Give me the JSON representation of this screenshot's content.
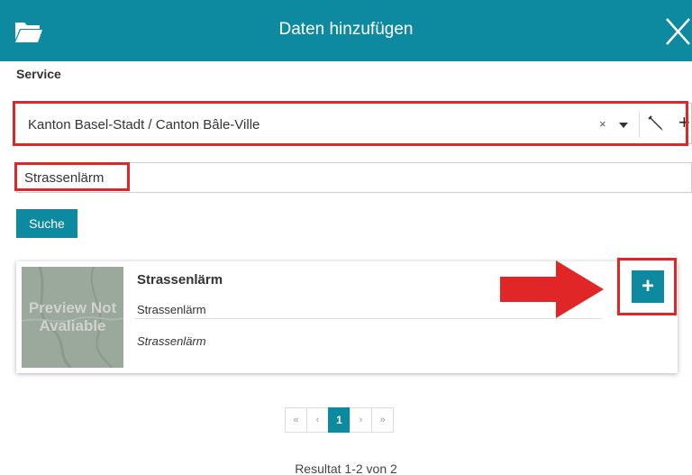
{
  "dialog": {
    "title": "Daten hinzufügen"
  },
  "service": {
    "label": "Service",
    "selected": "Kanton Basel-Stadt / Canton Bâle-Ville",
    "clear_symbol": "×",
    "add_symbol": "+"
  },
  "search": {
    "value": "Strassenlärm",
    "button_label": "Suche"
  },
  "results": [
    {
      "thumbnail_text": "Preview Not\nAvaliable",
      "title": "Strassenlärm",
      "subtitle": "Strassenlärm",
      "description": "Strassenlärm",
      "add_symbol": "+"
    }
  ],
  "pagination": {
    "first": "«",
    "prev": "‹",
    "current": "1",
    "next": "›",
    "last": "»"
  },
  "result_count": "Resultat 1-2 von 2",
  "icons": {
    "header_left": "folder-open-icon",
    "header_right": "close-icon",
    "edit": "pencil-icon",
    "annotation": "red-arrow-icon"
  },
  "colors": {
    "accent": "#0e8aa0",
    "highlight": "#e02626"
  }
}
